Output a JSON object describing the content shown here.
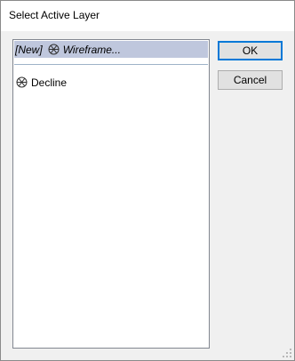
{
  "window": {
    "title": "Select Active Layer"
  },
  "list": {
    "items": [
      {
        "prefix": "[New]",
        "icon": "wireframe-icon",
        "label": "Wireframe..."
      },
      {
        "prefix": "",
        "icon": "wireframe-icon",
        "label": "Decline"
      }
    ],
    "selected_index": 0
  },
  "buttons": {
    "ok_label": "OK",
    "cancel_label": "Cancel"
  },
  "colors": {
    "selection": "#bfc7dd",
    "focus_border": "#0078d7"
  }
}
